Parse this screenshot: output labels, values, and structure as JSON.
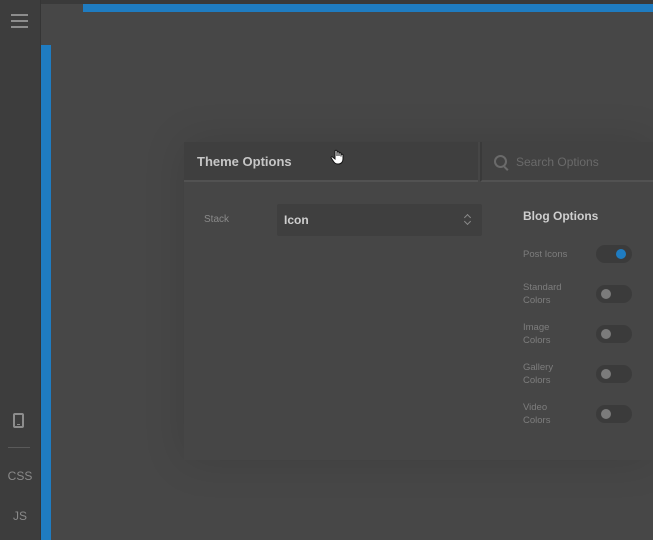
{
  "sidebar": {
    "menu_icon": "hamburger-icon",
    "device_icon": "mobile-device-icon",
    "css_label": "CSS",
    "js_label": "JS"
  },
  "panel": {
    "title": "Theme Options",
    "search_placeholder": "Search Options",
    "stack_label": "Stack",
    "stack_value": "Icon",
    "blog_title": "Blog Options",
    "options": [
      {
        "label_lines": [
          "Post Icons"
        ],
        "on": true
      },
      {
        "label_lines": [
          "Standard",
          "Colors"
        ],
        "on": false
      },
      {
        "label_lines": [
          "Image",
          "Colors"
        ],
        "on": false
      },
      {
        "label_lines": [
          "Gallery",
          "Colors"
        ],
        "on": false
      },
      {
        "label_lines": [
          "Video",
          "Colors"
        ],
        "on": false
      }
    ]
  },
  "colors": {
    "accent": "#1f7cc1",
    "background": "#474747",
    "panel": "#464646"
  },
  "cursor": "hand-pointer-icon"
}
